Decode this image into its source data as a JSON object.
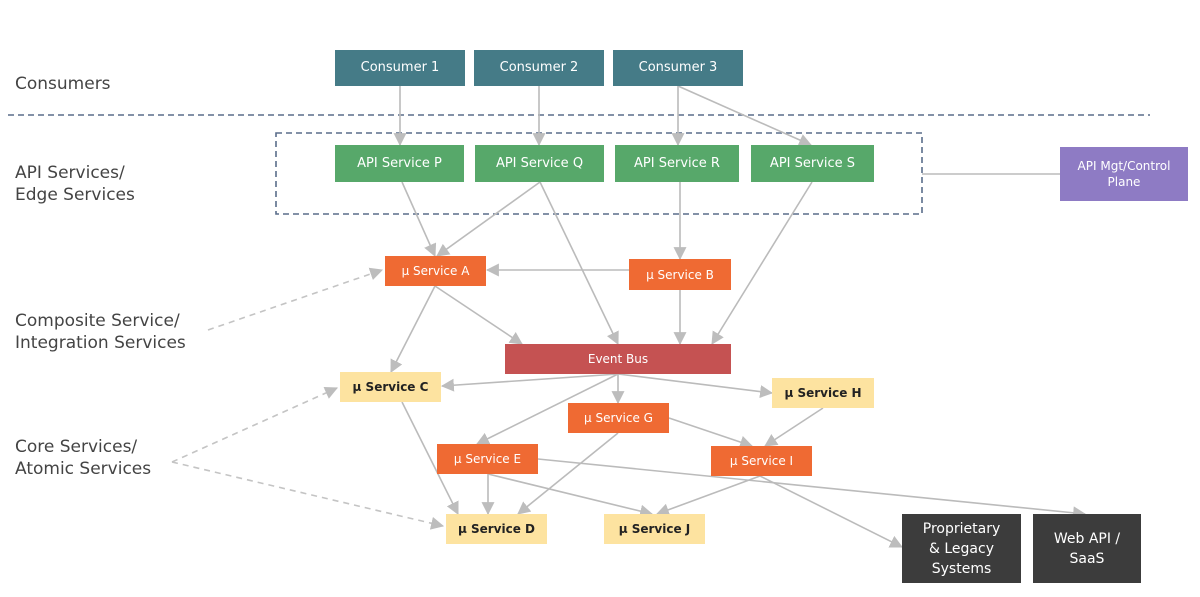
{
  "diagram": {
    "layers": [
      {
        "id": "consumers",
        "label": "Consumers"
      },
      {
        "id": "api",
        "label": "API Services/\nEdge Services"
      },
      {
        "id": "composite",
        "label": "Composite Service/\nIntegration Services"
      },
      {
        "id": "core",
        "label": "Core Services/\nAtomic Services"
      }
    ],
    "nodes": {
      "consumer1": {
        "label": "Consumer 1",
        "kind": "consumer"
      },
      "consumer2": {
        "label": "Consumer 2",
        "kind": "consumer"
      },
      "consumer3": {
        "label": "Consumer 3",
        "kind": "consumer"
      },
      "apiP": {
        "label": "API Service P",
        "kind": "api-service"
      },
      "apiQ": {
        "label": "API Service Q",
        "kind": "api-service"
      },
      "apiR": {
        "label": "API Service R",
        "kind": "api-service"
      },
      "apiS": {
        "label": "API Service S",
        "kind": "api-service"
      },
      "mgmt": {
        "label": "API Mgt/Control\nPlane",
        "kind": "control-plane"
      },
      "svcA": {
        "label": "µ Service A",
        "kind": "composite-service"
      },
      "svcB": {
        "label": "µ Service B",
        "kind": "composite-service"
      },
      "bus": {
        "label": "Event Bus",
        "kind": "event-bus"
      },
      "svcC": {
        "label": "µ Service C",
        "kind": "core-service"
      },
      "svcH": {
        "label": "µ Service H",
        "kind": "core-service"
      },
      "svcG": {
        "label": "µ Service G",
        "kind": "composite-service"
      },
      "svcE": {
        "label": "µ Service E",
        "kind": "composite-service"
      },
      "svcI": {
        "label": "µ Service I",
        "kind": "composite-service"
      },
      "svcD": {
        "label": "µ Service D",
        "kind": "core-service"
      },
      "svcJ": {
        "label": "µ Service J",
        "kind": "core-service"
      },
      "legacy": {
        "label": "Proprietary\n& Legacy\nSystems",
        "kind": "external-system"
      },
      "webapi": {
        "label": "Web API /\nSaaS",
        "kind": "external-system"
      }
    },
    "edges": [
      {
        "from": "consumer1",
        "to": "apiP"
      },
      {
        "from": "consumer2",
        "to": "apiQ"
      },
      {
        "from": "consumer3",
        "to": "apiR"
      },
      {
        "from": "consumer3",
        "to": "apiS"
      },
      {
        "from": "apiP",
        "to": "svcA"
      },
      {
        "from": "apiQ",
        "to": "svcA"
      },
      {
        "from": "apiQ",
        "to": "bus"
      },
      {
        "from": "apiR",
        "to": "svcB"
      },
      {
        "from": "apiS",
        "to": "bus"
      },
      {
        "from": "svcB",
        "to": "svcA"
      },
      {
        "from": "svcB",
        "to": "bus"
      },
      {
        "from": "svcA",
        "to": "svcC"
      },
      {
        "from": "svcA",
        "to": "bus"
      },
      {
        "from": "bus",
        "to": "svcC"
      },
      {
        "from": "bus",
        "to": "svcG"
      },
      {
        "from": "bus",
        "to": "svcH"
      },
      {
        "from": "bus",
        "to": "svcE"
      },
      {
        "from": "svcG",
        "to": "svcI"
      },
      {
        "from": "svcH",
        "to": "svcI"
      },
      {
        "from": "svcG",
        "to": "svcD"
      },
      {
        "from": "svcC",
        "to": "svcD"
      },
      {
        "from": "svcE",
        "to": "svcD"
      },
      {
        "from": "svcE",
        "to": "svcJ"
      },
      {
        "from": "svcE",
        "to": "webapi"
      },
      {
        "from": "svcI",
        "to": "svcJ"
      },
      {
        "from": "svcI",
        "to": "legacy"
      },
      {
        "from": "apiGroup",
        "to": "mgmt",
        "style": "plain"
      },
      {
        "from": "composite-label",
        "to": "svcA",
        "style": "dashed"
      },
      {
        "from": "core-label",
        "to": "svcC",
        "style": "dashed"
      },
      {
        "from": "core-label",
        "to": "svcD",
        "style": "dashed"
      }
    ],
    "colors": {
      "consumer": "#457b87",
      "api_service": "#57a86a",
      "composite_service": "#ef6a33",
      "core_service": "#fde3a0",
      "event_bus": "#c55252",
      "control_plane": "#8e7bc4",
      "external_system": "#3c3c3c",
      "connector": "#bbbbbb",
      "divider": "#5a6d8a"
    }
  }
}
